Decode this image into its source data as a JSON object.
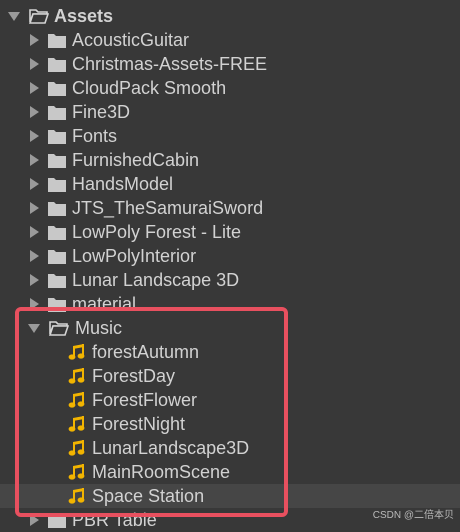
{
  "root": {
    "label": "Assets"
  },
  "folders": [
    "AcousticGuitar",
    "Christmas-Assets-FREE",
    "CloudPack Smooth",
    "Fine3D",
    "Fonts",
    "FurnishedCabin",
    "HandsModel",
    "JTS_TheSamuraiSword",
    "LowPoly Forest - Lite",
    "LowPolyInterior",
    "Lunar Landscape 3D",
    "material"
  ],
  "music": {
    "label": "Music",
    "items": [
      "forestAutumn",
      "ForestDay",
      "ForestFlower",
      "ForestNight",
      "LunarLandscape3D",
      "MainRoomScene",
      "Space Station"
    ]
  },
  "after_music": {
    "label": "PBR Table"
  },
  "watermark": "CSDN @二倍本贝",
  "colors": {
    "background": "#383838",
    "text": "#d2d2d2",
    "highlight_border": "#e8505f",
    "audio_icon": "#f2b400",
    "selected_row": "#464646"
  }
}
